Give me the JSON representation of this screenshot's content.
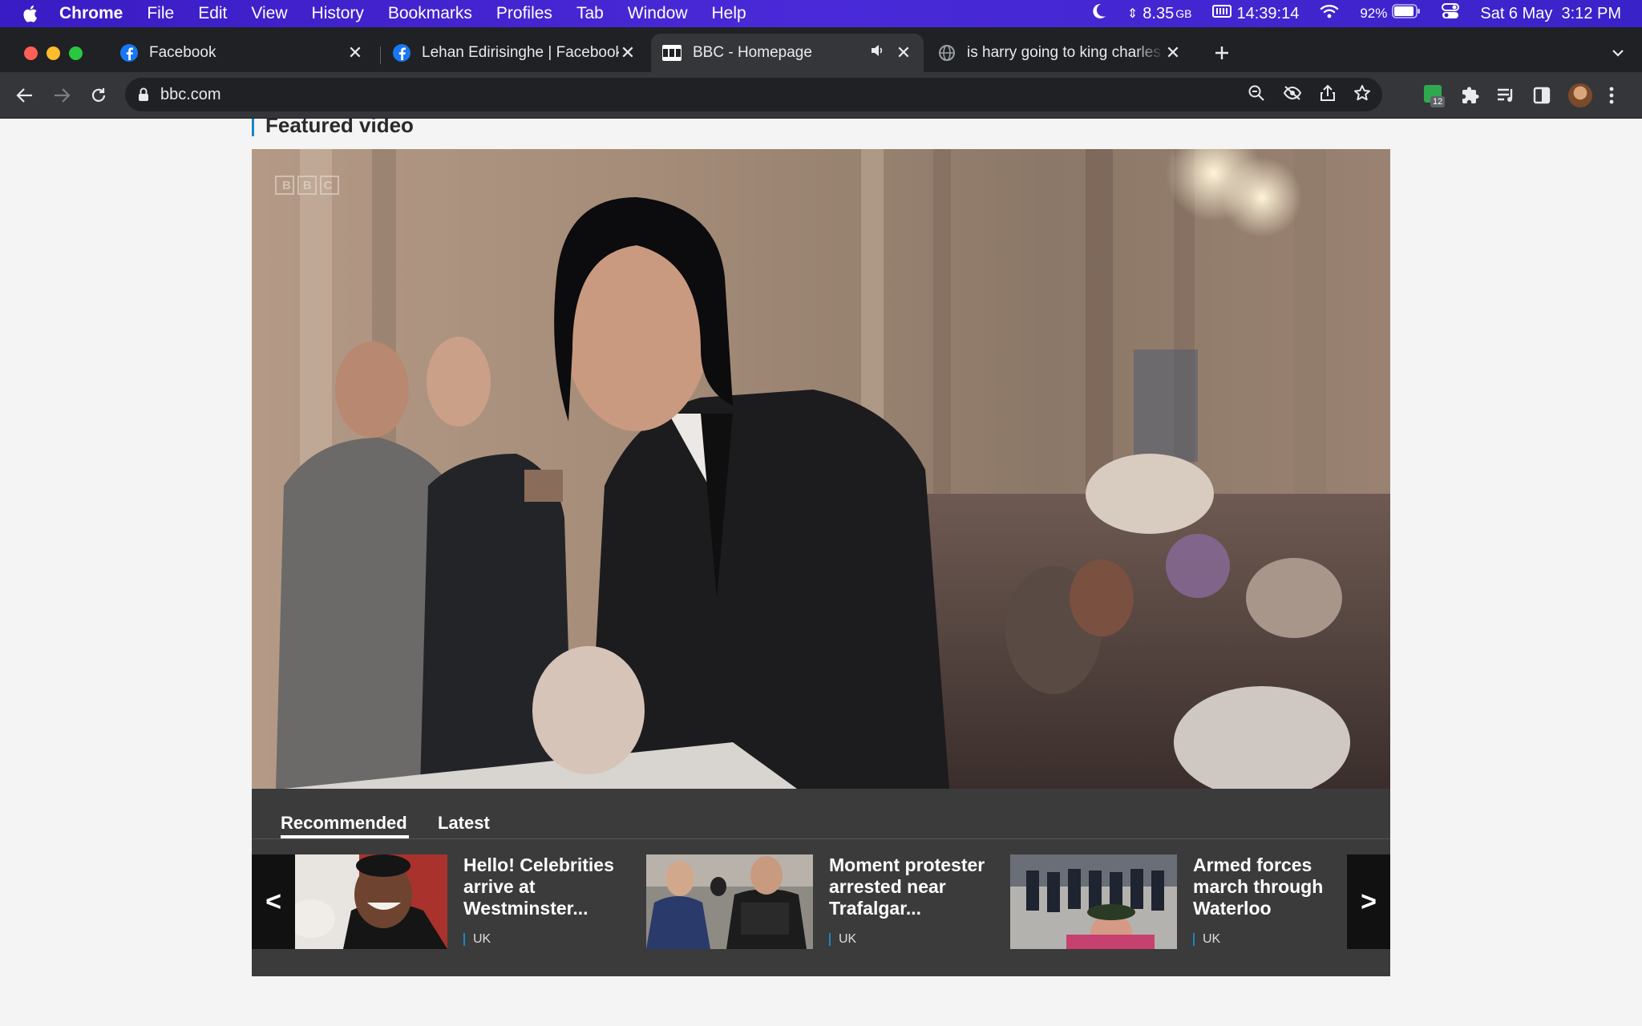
{
  "menubar": {
    "app_name": "Chrome",
    "items": [
      "File",
      "Edit",
      "View",
      "History",
      "Bookmarks",
      "Profiles",
      "Tab",
      "Window",
      "Help"
    ],
    "memory": "8.35",
    "memory_unit": "GB",
    "clock_stat": "14:39:14",
    "battery": "92%",
    "datetime": "Sat 6 May  3:12 PM"
  },
  "tabs": [
    {
      "title": "Facebook",
      "favicon": "facebook-icon",
      "active": false
    },
    {
      "title": "Lehan Edirisinghe | Facebook",
      "favicon": "facebook-icon",
      "active": false
    },
    {
      "title": "BBC - Homepage",
      "favicon": "bbc-icon",
      "active": true
    },
    {
      "title": "is harry going to king charles c",
      "favicon": "globe-icon",
      "active": false
    }
  ],
  "toolbar": {
    "url": "bbc.com",
    "extension_badge": "12"
  },
  "page": {
    "section_title": "Featured video",
    "watermark": "BBC",
    "video_tabs": [
      "Recommended",
      "Latest"
    ],
    "active_video_tab": "Recommended",
    "cards": [
      {
        "title": "Hello! Celebrities arrive at Westminster...",
        "tag": "UK"
      },
      {
        "title": "Moment protester arrested near Trafalgar...",
        "tag": "UK"
      },
      {
        "title": "Armed forces march through Waterloo",
        "tag": "UK"
      }
    ],
    "prev_arrow": "<",
    "next_arrow": ">"
  },
  "colors": {
    "menubar": "#3a1cc4",
    "tabstrip": "#202124",
    "toolbar": "#35363a",
    "accent": "#1a85c4"
  }
}
